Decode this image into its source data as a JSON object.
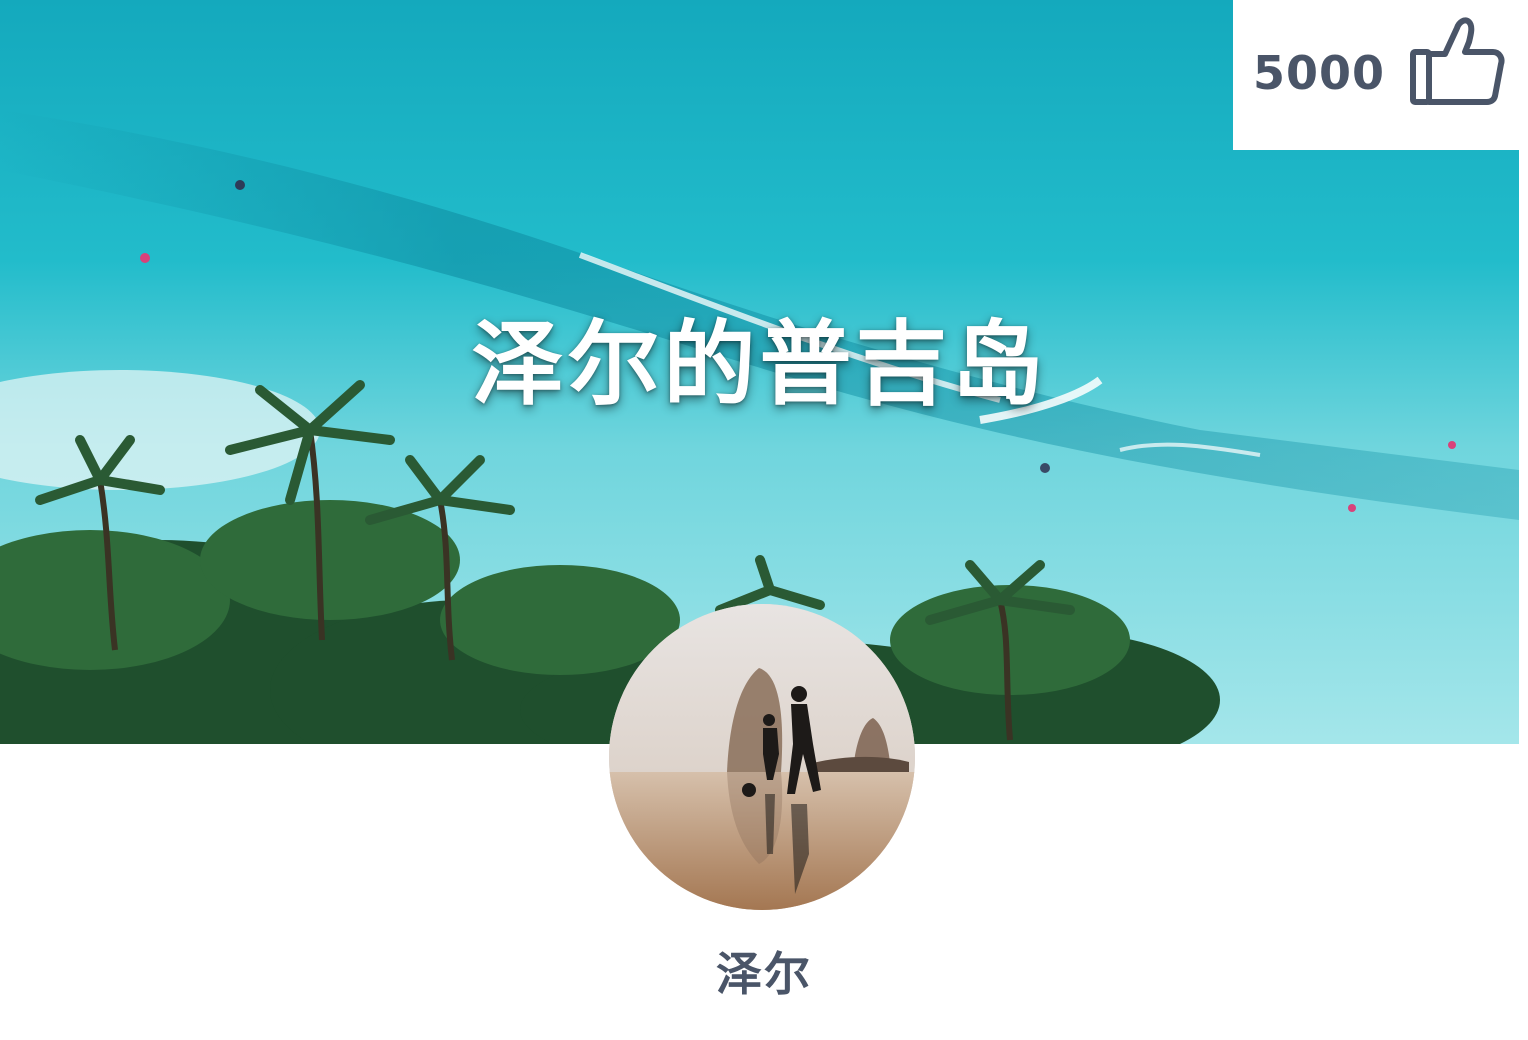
{
  "hero": {
    "title": "泽尔的普吉岛",
    "image_description_icon": "beach-palms-image"
  },
  "like": {
    "count": "5000",
    "icon": "thumbs-up-icon"
  },
  "profile": {
    "name": "泽尔",
    "avatar_icon": "avatar-image"
  },
  "colors": {
    "text_primary": "#4a5568",
    "title_text": "#ffffff",
    "sea": "#27c0cf"
  }
}
